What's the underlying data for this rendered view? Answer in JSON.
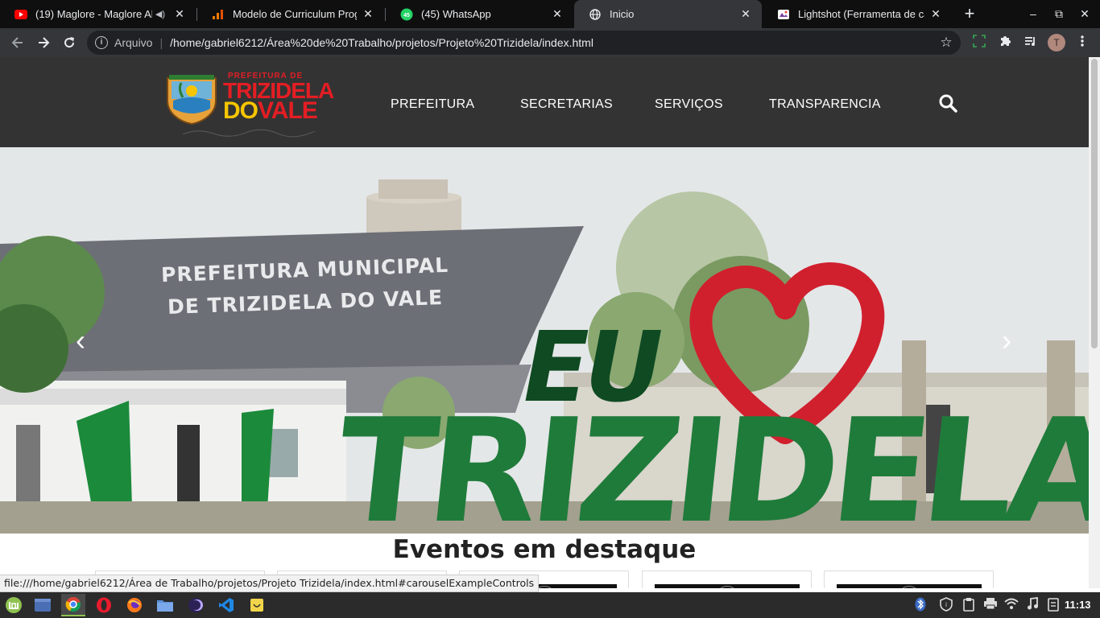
{
  "browser": {
    "tabs": [
      {
        "title": "(19) Maglore - Maglore Al",
        "favicon": "youtube-icon",
        "audio": true,
        "active": false
      },
      {
        "title": "Modelo de Curriculum Progra",
        "favicon": "analytics-icon",
        "audio": false,
        "active": false
      },
      {
        "title": "(45) WhatsApp",
        "favicon": "whatsapp-icon",
        "badge": "45",
        "audio": false,
        "active": false
      },
      {
        "title": "Inicio",
        "favicon": "globe-icon",
        "audio": false,
        "active": true
      },
      {
        "title": "Lightshot (Ferramenta de cap",
        "favicon": "lightshot-icon",
        "audio": false,
        "active": false
      }
    ],
    "new_tab": "+",
    "window_controls": {
      "minimize": "–",
      "maximize": "⧉",
      "close": "✕"
    },
    "address": {
      "scheme_label": "Arquivo",
      "url": "/home/gabriel6212/Área%20de%20Trabalho/projetos/Projeto%20Trizidela/index.html"
    },
    "profile_initial": "T",
    "status_url": "file:///home/gabriel6212/Área de Trabalho/projetos/Projeto Trizidela/index.html#carouselExampleControls"
  },
  "site": {
    "logo": {
      "line1": "PREFEITURA DE",
      "line2": "TRIZIDELA",
      "line3_a": "DO",
      "line3_b": "VALE"
    },
    "nav": [
      "PREFEITURA",
      "SECRETARIAS",
      "SERVIÇOS",
      "TRANSPARENCIA"
    ],
    "carousel": {
      "building_line1": "PREFEITURA MUNICIPAL",
      "building_line2": "DE TRIZIDELA DO VALE",
      "sign_top": "EU",
      "sign_bottom": "TRIZIDELA",
      "prev": "‹",
      "next": "›"
    },
    "events_title": "Eventos em destaque"
  },
  "taskbar": {
    "clock": "11:13",
    "apps": [
      "mint-menu-icon",
      "show-desktop-icon",
      "chrome-icon",
      "opera-icon",
      "firefox-icon",
      "files-icon",
      "eclipse-icon",
      "vscode-icon",
      "notes-icon"
    ]
  },
  "colors": {
    "header_bg": "#333333",
    "logo_red": "#e31e24",
    "logo_yellow": "#f6c500",
    "sign_green": "#1f7b3a",
    "heart_red": "#d0202e"
  }
}
